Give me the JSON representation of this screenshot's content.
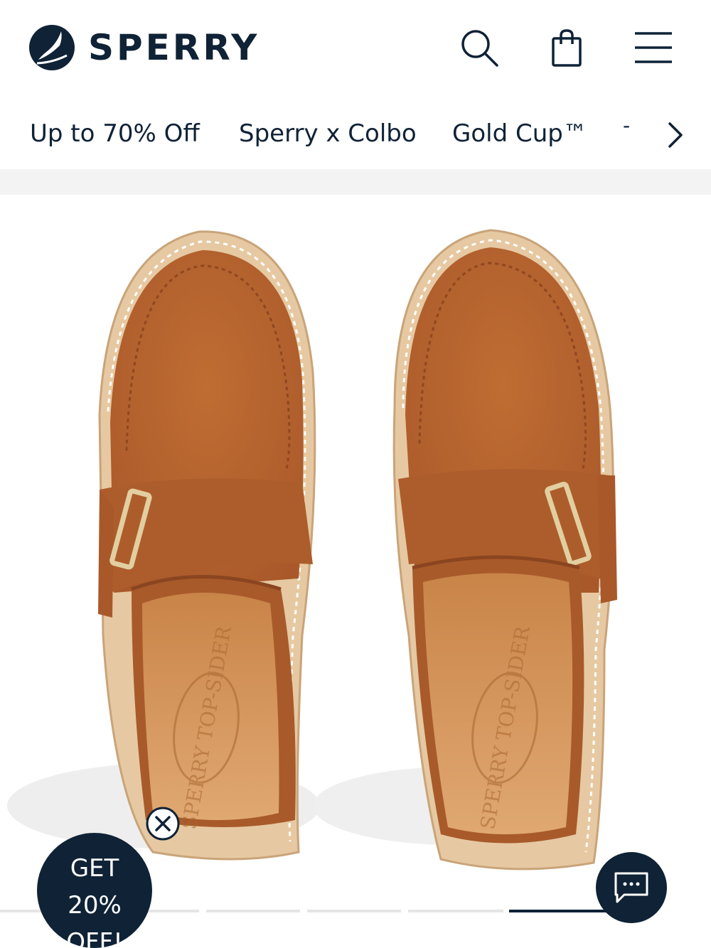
{
  "header": {
    "brand": "SPERRY",
    "icons": [
      "search-icon",
      "shopping-bag-icon",
      "hamburger-menu-icon"
    ]
  },
  "nav": {
    "items": [
      "Up to 70% Off",
      "Sperry x Colbo",
      "Gold Cup™",
      "-"
    ],
    "next_icon": "chevron-right-icon"
  },
  "product": {
    "image": "brown suede buckle mule clogs, top view",
    "insole_brand": "SPERRY TOP-SIDER",
    "gallery_pages": 6,
    "active_page": 6
  },
  "promo": {
    "line1": "GET",
    "line2": "20%",
    "line3": "OFF!",
    "close_icon": "close-icon"
  },
  "chat": {
    "icon": "chat-icon"
  },
  "colors": {
    "navy": "#0f2236",
    "suede": "#b5612b",
    "insole": "#d89a62"
  }
}
